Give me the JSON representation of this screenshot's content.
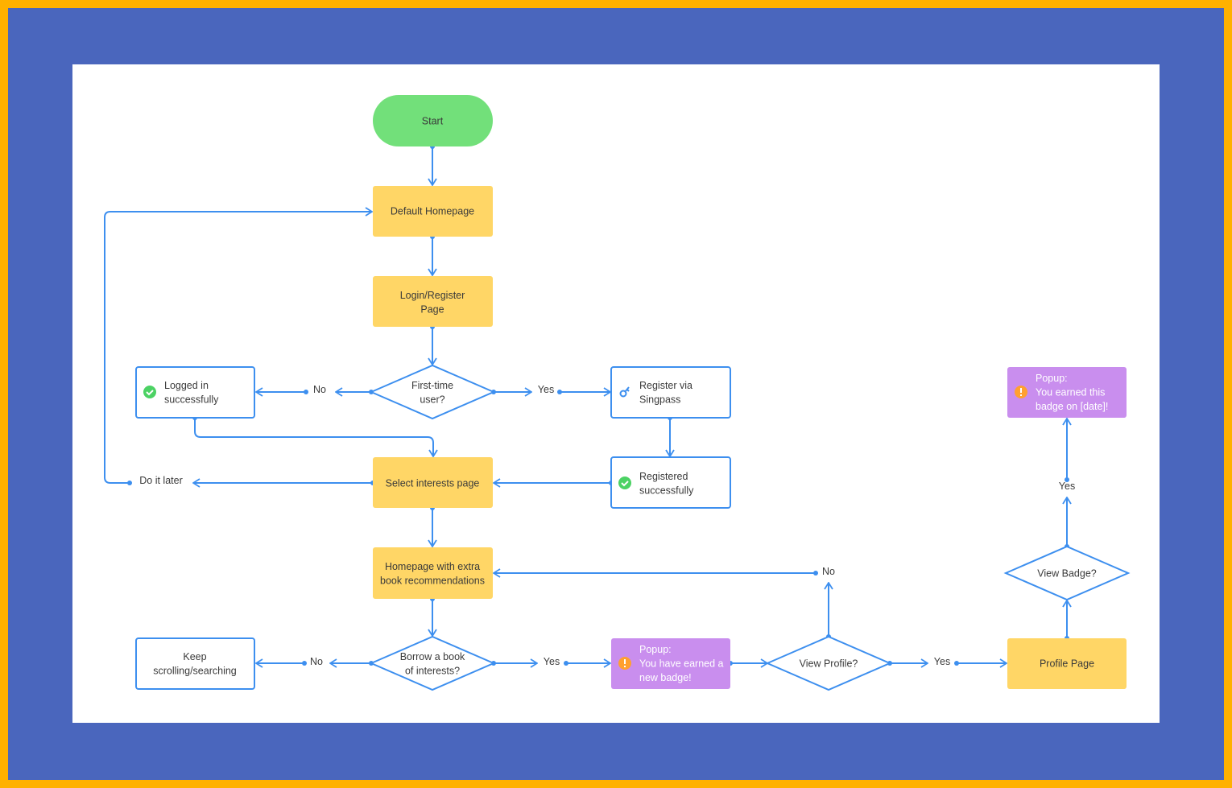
{
  "colors": {
    "start": "#72E07A",
    "page": "#FFD666",
    "popup": "#C98EEE",
    "outline": "#3D8FEF",
    "frame_outer": "#FFB100",
    "frame_inner": "#4A66BD",
    "check": "#4CD264",
    "warning": "#FFA030"
  },
  "nodes": {
    "start": "Start",
    "default_homepage": "Default Homepage",
    "login_register": [
      "Login/Register",
      "Page"
    ],
    "first_time": [
      "First-time",
      "user?"
    ],
    "logged_in": [
      "Logged in",
      "successfully"
    ],
    "register_singpass": [
      "Register via",
      "Singpass"
    ],
    "registered": [
      "Registered",
      "successfully"
    ],
    "select_interests": "Select interests page",
    "homepage_extra": [
      "Homepage with extra",
      "book recommendations"
    ],
    "borrow": [
      "Borrow a book",
      "of interests?"
    ],
    "keep_scrolling": [
      "Keep",
      "scrolling/searching"
    ],
    "popup_new_badge": [
      "Popup:",
      "You have earned a",
      "new badge!"
    ],
    "view_profile": "View Profile?",
    "profile_page": "Profile Page",
    "view_badge": "View Badge?",
    "popup_earned": [
      "Popup:",
      "You earned this",
      "badge on [date]!"
    ]
  },
  "edge_labels": {
    "first_no": "No",
    "first_yes": "Yes",
    "do_it_later": "Do it later",
    "borrow_no": "No",
    "borrow_yes": "Yes",
    "profile_no": "No",
    "profile_yes": "Yes",
    "badge_yes": "Yes"
  },
  "icons": {
    "logged_in": "check-circle-icon",
    "register_singpass": "key-icon",
    "registered": "check-circle-icon",
    "popup_new_badge": "warning-icon",
    "popup_earned": "warning-icon"
  }
}
